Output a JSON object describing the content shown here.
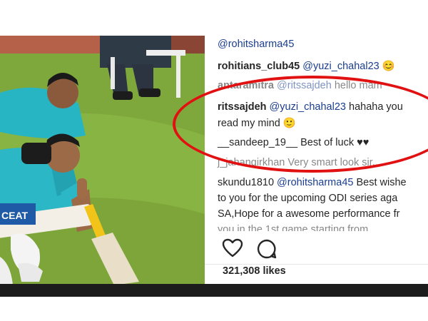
{
  "post": {
    "caption_mention": "@rohitsharma45",
    "comments": [
      {
        "user": "rohitians_club45",
        "mention": "@yuzi_chahal23",
        "text": "😊"
      },
      {
        "user": "antaramitra",
        "mention": "@ritssajdeh",
        "text": "hello mam"
      },
      {
        "user": "ritssajdeh",
        "mention": "@yuzi_chahal23",
        "text": "hahaha you",
        "text2": "read my mind 🙂"
      },
      {
        "user": "__sandeep_19__",
        "text": "Best of luck ♥♥"
      },
      {
        "user": "j_jahangirkhan",
        "text": "Very smart look sir..."
      },
      {
        "user": "skundu1810",
        "mention": "@rohitsharma45",
        "text": "Best wishe",
        "text2": "to you for the upcoming ODI series aga",
        "text3": "SA,Hope for a awesome performance fr",
        "text4": "you in the 1st game starting from"
      }
    ],
    "likes": "321,308 likes",
    "icons": [
      "heart-icon",
      "comment-icon"
    ]
  },
  "photo": {
    "bat_brand": "CEAT"
  },
  "colors": {
    "highlight_ellipse": "#e11111",
    "mention": "#1a3d8f",
    "shirt": "#27b5c4"
  }
}
